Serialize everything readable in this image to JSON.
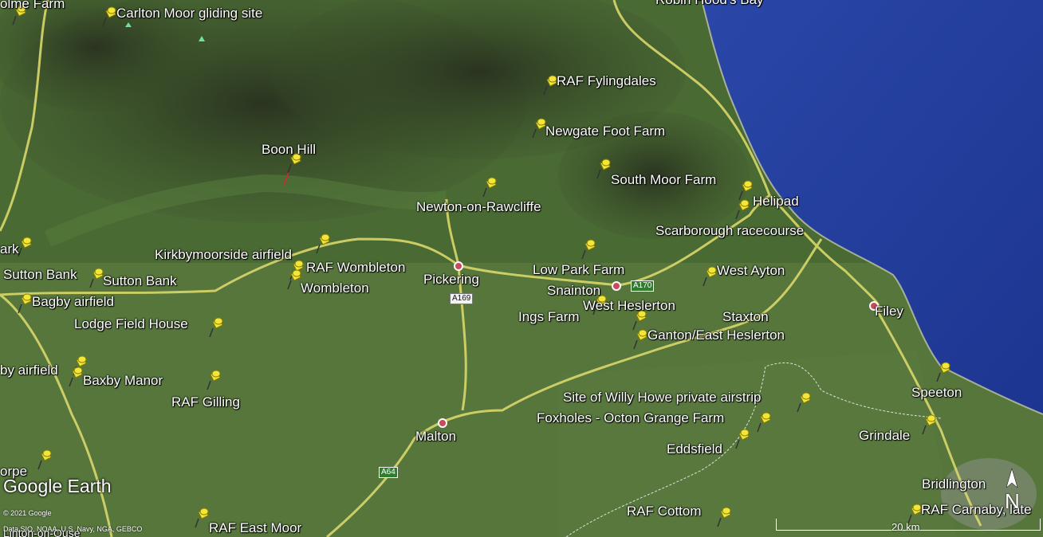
{
  "app": {
    "logo_text": "Google Earth"
  },
  "colors": {
    "sea": "#1f3a9a",
    "land_dark": "#2d3a22",
    "land": "#4b6a36",
    "road": "#d9d76a",
    "pin": "#f3e63a",
    "town_dot": "#c94a5a"
  },
  "labels": {
    "robin_hoods_bay": "Robin Hood's Bay",
    "carlton_moor": "Carlton Moor gliding site",
    "holme_farm": "olme Farm",
    "raf_fylingdales": "RAF Fylingdales",
    "newgate_foot": "Newgate Foot Farm",
    "boon_hill": "Boon Hill",
    "south_moor": "South Moor Farm",
    "helipad": "Helipad",
    "newton_rawcliffe": "Newton-on-Rawcliffe",
    "scarborough_rc": "Scarborough racecourse",
    "kirkbymoorside": "Kirkbymoorside airfield",
    "raf_wombleton": "RAF Wombleton",
    "wombleton": "Wombleton",
    "pickering": "Pickering",
    "low_park": "Low Park Farm",
    "snainton": "Snainton",
    "west_ayton": "West Ayton",
    "park_left": "ark",
    "sutton_bank_a": "Sutton Bank",
    "sutton_bank_b": "Sutton Bank",
    "bagby": "Bagby airfield",
    "west_heslerton": "West Heslerton",
    "ings_farm": "Ings Farm",
    "staxton": "Staxton",
    "filey": "Filey",
    "lodge_field": "Lodge Field House",
    "ganton": "Ganton/East Heslerton",
    "by_airfield": "by airfield",
    "baxby_manor": "Baxby Manor",
    "raf_gilling": "RAF Gilling",
    "speeton": "Speeton",
    "willy_howe": "Site of Willy Howe private airstrip",
    "foxholes": "Foxholes - Octon Grange Farm",
    "grindale": "Grindale",
    "malton": "Malton",
    "eddsfield": "Eddsfield",
    "orpe": "orpe",
    "bridlington": "Bridlington",
    "raf_cottom": "RAF Cottom",
    "raf_carnaby": "RAF Carnaby, late",
    "raf_east_moor": "RAF East Moor",
    "linton": "Linton-on-Ouse"
  },
  "roads": {
    "a170": "A170",
    "a169": "A169",
    "a64": "A64"
  },
  "attribution": {
    "copyright": "© 2021 Google",
    "data": "Data SIO, NOAA, U.S. Navy, NGA, GEBCO"
  },
  "scale": {
    "label": "20 km"
  },
  "compass": {
    "label": "N"
  }
}
